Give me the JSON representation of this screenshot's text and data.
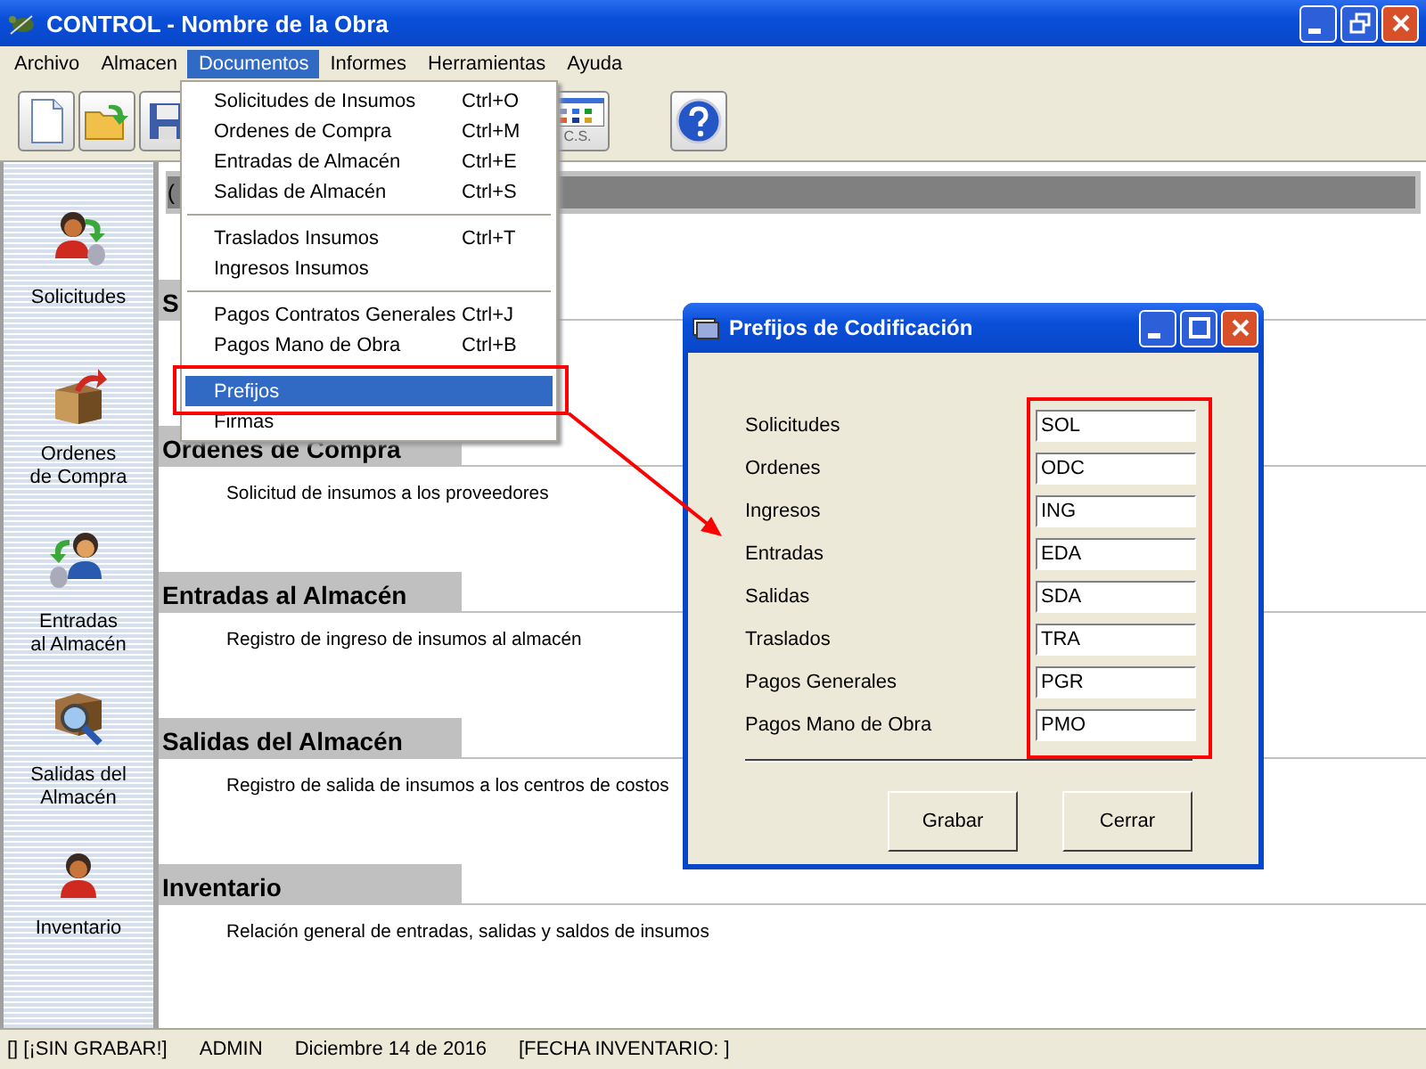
{
  "window": {
    "title": "CONTROL - Nombre de la Obra"
  },
  "menu_bar": [
    {
      "label": "Archivo",
      "selected": false
    },
    {
      "label": "Almacen",
      "selected": false
    },
    {
      "label": "Documentos",
      "selected": true
    },
    {
      "label": "Informes",
      "selected": false
    },
    {
      "label": "Herramientas",
      "selected": false
    },
    {
      "label": "Ayuda",
      "selected": false
    }
  ],
  "toolbar": {
    "calendar_button_label": "C.S."
  },
  "sidebar": {
    "items": [
      {
        "label": "Solicitudes",
        "kind": "request"
      },
      {
        "label": "Ordenes\nde Compra",
        "kind": "order"
      },
      {
        "label": "Entradas\nal Almacén",
        "kind": "entry"
      },
      {
        "label": "Salidas del\nAlmacén",
        "kind": "exit"
      },
      {
        "label": "Inventario",
        "kind": "inventory"
      }
    ]
  },
  "content": {
    "header_bar": "(",
    "sections": [
      {
        "title": "S"
      },
      {
        "title": "Ordenes de Compra",
        "description": "Solicitud de insumos a los proveedores"
      },
      {
        "title": "Entradas al Almacén",
        "description": "Registro de ingreso de insumos al almacén"
      },
      {
        "title": "Salidas del Almacén",
        "description": "Registro de salida de insumos a los centros de costos"
      },
      {
        "title": "Inventario",
        "description": "Relación general de entradas, salidas y saldos de insumos"
      }
    ]
  },
  "menu": {
    "items": [
      {
        "kind": "item",
        "label": "Solicitudes de Insumos",
        "shortcut": "Ctrl+O",
        "selected": false
      },
      {
        "kind": "item",
        "label": "Ordenes de Compra",
        "shortcut": "Ctrl+M",
        "selected": false
      },
      {
        "kind": "item",
        "label": "Entradas de Almacén",
        "shortcut": "Ctrl+E",
        "selected": false
      },
      {
        "kind": "item",
        "label": "Salidas de Almacén",
        "shortcut": "Ctrl+S",
        "selected": false
      },
      {
        "kind": "separator"
      },
      {
        "kind": "item",
        "label": "Traslados Insumos",
        "shortcut": "Ctrl+T",
        "selected": false
      },
      {
        "kind": "item",
        "label": "Ingresos Insumos",
        "selected": false
      },
      {
        "kind": "separator"
      },
      {
        "kind": "item",
        "label": "Pagos Contratos Generales",
        "shortcut": "Ctrl+J",
        "selected": false
      },
      {
        "kind": "item",
        "label": "Pagos Mano de Obra",
        "shortcut": "Ctrl+B",
        "selected": false
      },
      {
        "kind": "separator"
      },
      {
        "kind": "item",
        "label": "Prefijos",
        "selected": true
      },
      {
        "kind": "item",
        "label": "Firmas",
        "selected": false
      }
    ]
  },
  "dialog": {
    "title": "Prefijos de Codificación",
    "fields": [
      {
        "label": "Solicitudes",
        "value": "SOL"
      },
      {
        "label": "Ordenes",
        "value": "ODC"
      },
      {
        "label": "Ingresos",
        "value": "ING"
      },
      {
        "label": "Entradas",
        "value": "EDA"
      },
      {
        "label": "Salidas",
        "value": "SDA"
      },
      {
        "label": "Traslados",
        "value": "TRA"
      },
      {
        "label": "Pagos Generales",
        "value": "PGR"
      },
      {
        "label": "Pagos Mano de Obra",
        "value": "PMO"
      }
    ],
    "buttons": [
      "Grabar",
      "Cerrar"
    ]
  },
  "status_bar": [
    "[] [¡SIN GRABAR!]",
    "ADMIN",
    "Diciembre 14 de 2016",
    "[FECHA INVENTARIO: ]"
  ]
}
